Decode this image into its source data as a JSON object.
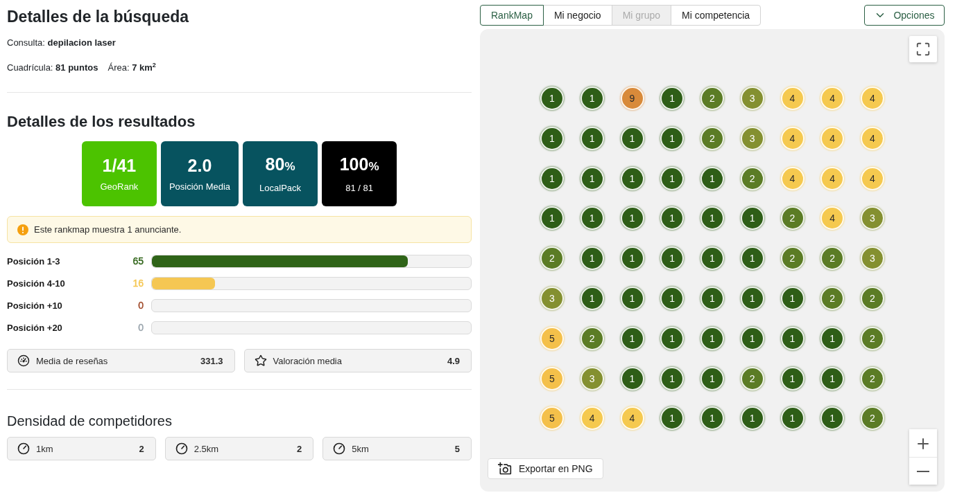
{
  "search_details": {
    "title": "Detalles de la búsqueda",
    "query": "Consulta: **depilacion laser**",
    "grid": "Cuadrícula: **81 puntos**",
    "area": "Área: **7 km**$^{2}$"
  },
  "results": {
    "title": "Detalles de los resultados",
    "stats": [
      {
        "value": "1/41",
        "label": "GeoRank",
        "color": "#4cc300"
      },
      {
        "value": "2.0",
        "label": "Posición Media",
        "color": "#07535f"
      },
      {
        "value": "80",
        "unit": "%",
        "label": "LocalPack",
        "color": "#07535f"
      },
      {
        "value": "100",
        "unit": "%",
        "label": "81 / 81",
        "color": "#000000"
      }
    ],
    "notice": "Este rankmap muestra 1 anunciante.",
    "positions": [
      {
        "label": "Posición 1-3",
        "count": "65",
        "level": 0.8025,
        "color": "#2f6418"
      },
      {
        "label": "Posición 4-10",
        "count": "16",
        "level": 0.1975,
        "color": "#f5c753"
      },
      {
        "label": "Posición +10",
        "count": "0",
        "level": 0,
        "color": "#a04a2a"
      },
      {
        "label": "Posición +20",
        "count": "0",
        "level": 0,
        "color": "#9aa5ad"
      }
    ],
    "metrics": [
      {
        "kind": "gauge",
        "label": "Media de reseñas",
        "value": "331.3"
      },
      {
        "kind": "star",
        "label": "Valoración media",
        "value": "4.9"
      }
    ]
  },
  "competitor_density": {
    "title": "Densidad de competidores",
    "items": [
      {
        "label": "1km",
        "value": "2"
      },
      {
        "label": "2.5km",
        "value": "2"
      },
      {
        "label": "5km",
        "value": "5"
      }
    ]
  },
  "map_tabs": [
    {
      "label": "RankMap",
      "selected": true,
      "disabled": false
    },
    {
      "label": "Mi negocio",
      "selected": false,
      "disabled": false
    },
    {
      "label": "Mi grupo",
      "selected": false,
      "disabled": true
    },
    {
      "label": "Mi competencia",
      "selected": false,
      "disabled": false
    }
  ],
  "options_button": "Opciones",
  "map": {
    "markers": [
      [
        {
          "rank": "1",
          "color": "#2e5e17"
        },
        {
          "rank": "1",
          "color": "#2e5e17"
        },
        {
          "rank": "9",
          "color": "#d88a3a"
        },
        {
          "rank": "1",
          "color": "#2e5e17"
        },
        {
          "rank": "2",
          "color": "#5b7c25"
        },
        {
          "rank": "3",
          "color": "#849030"
        },
        {
          "rank": "4",
          "color": "#f5c94f"
        },
        {
          "rank": "4",
          "color": "#f5c94f"
        },
        {
          "rank": "4",
          "color": "#f5c94f"
        }
      ],
      [
        {
          "rank": "1",
          "color": "#2e5e17"
        },
        {
          "rank": "1",
          "color": "#2e5e17"
        },
        {
          "rank": "1",
          "color": "#2e5e17"
        },
        {
          "rank": "1",
          "color": "#2e5e17"
        },
        {
          "rank": "2",
          "color": "#5b7c25"
        },
        {
          "rank": "3",
          "color": "#849030"
        },
        {
          "rank": "4",
          "color": "#f5c94f"
        },
        {
          "rank": "4",
          "color": "#f5c94f"
        },
        {
          "rank": "4",
          "color": "#f5c94f"
        }
      ],
      [
        {
          "rank": "1",
          "color": "#2e5e17"
        },
        {
          "rank": "1",
          "color": "#2e5e17"
        },
        {
          "rank": "1",
          "color": "#2e5e17"
        },
        {
          "rank": "1",
          "color": "#2e5e17"
        },
        {
          "rank": "1",
          "color": "#2e5e17"
        },
        {
          "rank": "2",
          "color": "#5b7c25"
        },
        {
          "rank": "4",
          "color": "#f5c94f"
        },
        {
          "rank": "4",
          "color": "#f5c94f"
        },
        {
          "rank": "4",
          "color": "#f5c94f"
        }
      ],
      [
        {
          "rank": "1",
          "color": "#2e5e17"
        },
        {
          "rank": "1",
          "color": "#2e5e17"
        },
        {
          "rank": "1",
          "color": "#2e5e17"
        },
        {
          "rank": "1",
          "color": "#2e5e17"
        },
        {
          "rank": "1",
          "color": "#2e5e17"
        },
        {
          "rank": "1",
          "color": "#2e5e17"
        },
        {
          "rank": "2",
          "color": "#5b7c25"
        },
        {
          "rank": "4",
          "color": "#f5c94f"
        },
        {
          "rank": "3",
          "color": "#849030"
        }
      ],
      [
        {
          "rank": "2",
          "color": "#5b7c25"
        },
        {
          "rank": "1",
          "color": "#2e5e17"
        },
        {
          "rank": "1",
          "color": "#2e5e17"
        },
        {
          "rank": "1",
          "color": "#2e5e17"
        },
        {
          "rank": "1",
          "color": "#2e5e17"
        },
        {
          "rank": "1",
          "color": "#2e5e17"
        },
        {
          "rank": "2",
          "color": "#5b7c25"
        },
        {
          "rank": "2",
          "color": "#5b7c25"
        },
        {
          "rank": "3",
          "color": "#849030"
        }
      ],
      [
        {
          "rank": "3",
          "color": "#849030"
        },
        {
          "rank": "1",
          "color": "#2e5e17"
        },
        {
          "rank": "1",
          "color": "#2e5e17"
        },
        {
          "rank": "1",
          "color": "#2e5e17"
        },
        {
          "rank": "1",
          "color": "#2e5e17"
        },
        {
          "rank": "1",
          "color": "#2e5e17"
        },
        {
          "rank": "1",
          "color": "#2e5e17"
        },
        {
          "rank": "2",
          "color": "#5b7c25"
        },
        {
          "rank": "2",
          "color": "#5b7c25"
        }
      ],
      [
        {
          "rank": "5",
          "color": "#f4c04a"
        },
        {
          "rank": "2",
          "color": "#5b7c25"
        },
        {
          "rank": "1",
          "color": "#2e5e17"
        },
        {
          "rank": "1",
          "color": "#2e5e17"
        },
        {
          "rank": "1",
          "color": "#2e5e17"
        },
        {
          "rank": "1",
          "color": "#2e5e17"
        },
        {
          "rank": "1",
          "color": "#2e5e17"
        },
        {
          "rank": "1",
          "color": "#2e5e17"
        },
        {
          "rank": "2",
          "color": "#5b7c25"
        }
      ],
      [
        {
          "rank": "5",
          "color": "#f4c04a"
        },
        {
          "rank": "3",
          "color": "#849030"
        },
        {
          "rank": "1",
          "color": "#2e5e17"
        },
        {
          "rank": "1",
          "color": "#2e5e17"
        },
        {
          "rank": "1",
          "color": "#2e5e17"
        },
        {
          "rank": "2",
          "color": "#5b7c25"
        },
        {
          "rank": "1",
          "color": "#2e5e17"
        },
        {
          "rank": "1",
          "color": "#2e5e17"
        },
        {
          "rank": "2",
          "color": "#5b7c25"
        }
      ],
      [
        {
          "rank": "5",
          "color": "#f4c04a"
        },
        {
          "rank": "4",
          "color": "#f5c94f"
        },
        {
          "rank": "4",
          "color": "#f5c94f"
        },
        {
          "rank": "1",
          "color": "#2e5e17"
        },
        {
          "rank": "1",
          "color": "#2e5e17"
        },
        {
          "rank": "1",
          "color": "#2e5e17"
        },
        {
          "rank": "1",
          "color": "#2e5e17"
        },
        {
          "rank": "1",
          "color": "#2e5e17"
        },
        {
          "rank": "2",
          "color": "#5b7c25"
        }
      ]
    ],
    "export_button": "Exportar en PNG"
  }
}
